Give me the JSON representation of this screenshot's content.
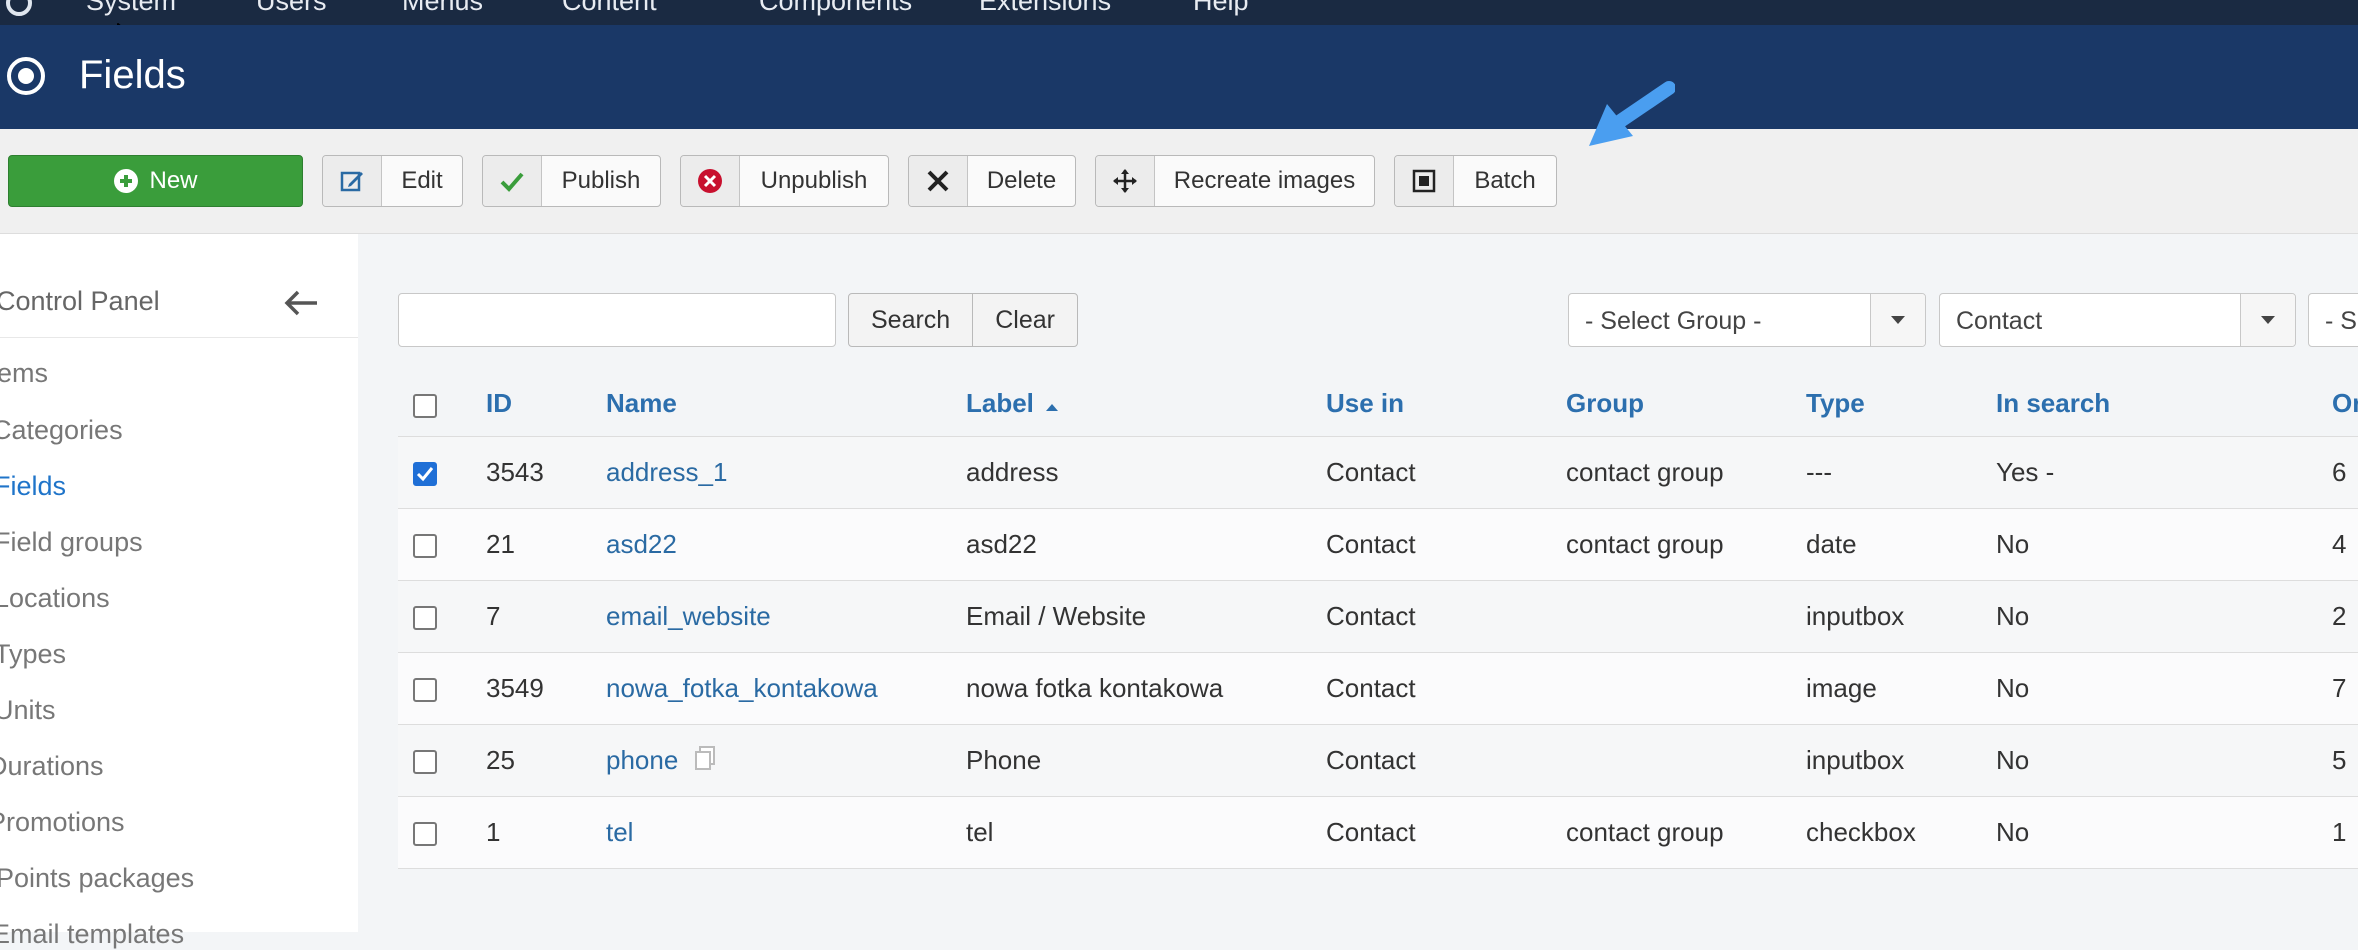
{
  "topnav": {
    "items": [
      "System",
      "Users",
      "Menus",
      "Content",
      "Components",
      "Extensions",
      "Help"
    ]
  },
  "header": {
    "title": "Fields"
  },
  "toolbar": {
    "new": "New",
    "edit": "Edit",
    "publish": "Publish",
    "unpublish": "Unpublish",
    "delete": "Delete",
    "recreate": "Recreate images",
    "batch": "Batch"
  },
  "sidebar": {
    "control_panel": "Control Panel",
    "items": [
      {
        "label": "Items",
        "active": false
      },
      {
        "label": "Categories",
        "active": false
      },
      {
        "label": "Fields",
        "active": true
      },
      {
        "label": "Field groups",
        "active": false
      },
      {
        "label": "Locations",
        "active": false
      },
      {
        "label": "Types",
        "active": false
      },
      {
        "label": "Units",
        "active": false
      },
      {
        "label": "Durations",
        "active": false
      },
      {
        "label": "Promotions",
        "active": false
      },
      {
        "label": "Points packages",
        "active": false
      },
      {
        "label": "Email templates",
        "active": false
      }
    ]
  },
  "filters": {
    "search_value": "",
    "search_label": "Search",
    "clear_label": "Clear",
    "group_select": "- Select Group -",
    "context_select": "Contact",
    "third_select": "- S"
  },
  "table": {
    "headers": {
      "id": "ID",
      "name": "Name",
      "label": "Label",
      "use_in": "Use in",
      "group": "Group",
      "type": "Type",
      "in_search": "In search",
      "ordering": "Or"
    },
    "rows": [
      {
        "checked": true,
        "id": "3543",
        "name": "address_1",
        "label": "address",
        "use_in": "Contact",
        "group": "contact group",
        "type": "---",
        "in_search": "Yes -",
        "ordering": "6"
      },
      {
        "checked": false,
        "id": "21",
        "name": "asd22",
        "label": "asd22",
        "use_in": "Contact",
        "group": "contact group",
        "type": "date",
        "in_search": "No",
        "ordering": "4"
      },
      {
        "checked": false,
        "id": "7",
        "name": "email_website",
        "label": "Email / Website",
        "use_in": "Contact",
        "group": "",
        "type": "inputbox",
        "in_search": "No",
        "ordering": "2"
      },
      {
        "checked": false,
        "id": "3549",
        "name": "nowa_fotka_kontakowa",
        "label": "nowa fotka kontakowa",
        "use_in": "Contact",
        "group": "",
        "type": "image",
        "in_search": "No",
        "ordering": "7"
      },
      {
        "checked": false,
        "id": "25",
        "name": "phone",
        "label": "Phone",
        "use_in": "Contact",
        "group": "",
        "type": "inputbox",
        "in_search": "No",
        "ordering": "5"
      },
      {
        "checked": false,
        "id": "1",
        "name": "tel",
        "label": "tel",
        "use_in": "Contact",
        "group": "contact group",
        "type": "checkbox",
        "in_search": "No",
        "ordering": "1"
      }
    ]
  },
  "colors": {
    "header_bg": "#1a3867",
    "topnav_bg": "#1a2a42",
    "new_button": "#3a9d3b",
    "link": "#2a6aa3",
    "active_sidebar": "#1f74c9",
    "annotation_arrow": "#4a9ef0"
  }
}
